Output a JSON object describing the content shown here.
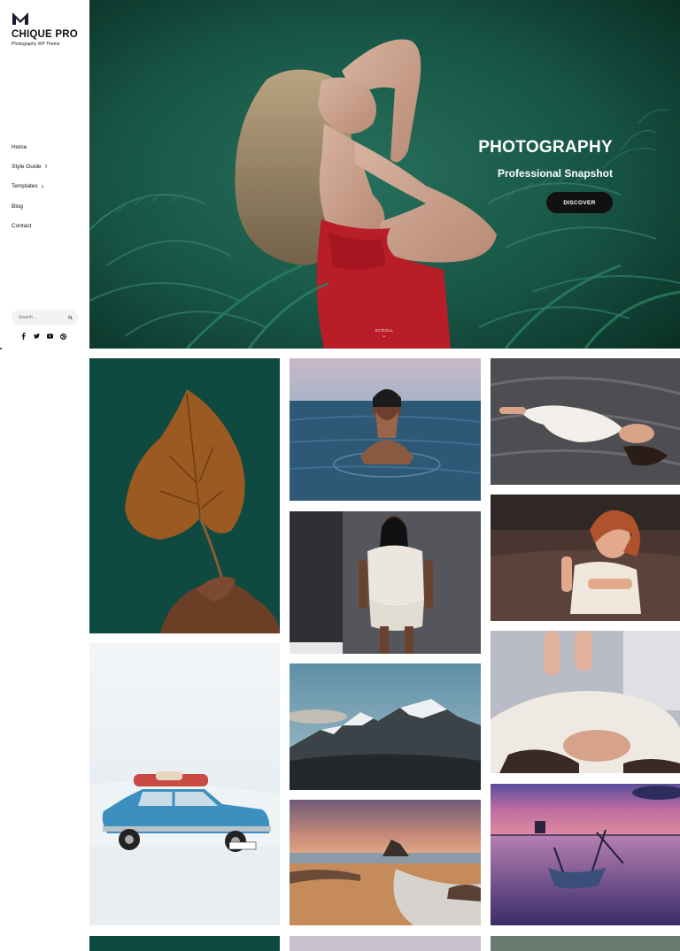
{
  "site": {
    "title": "CHIQUE PRO",
    "tagline": "Photography WP Theme"
  },
  "nav": {
    "items": [
      {
        "label": "Home",
        "has_submenu": false
      },
      {
        "label": "Style Guide",
        "has_submenu": true
      },
      {
        "label": "Templates",
        "has_submenu": true
      },
      {
        "label": "Blog",
        "has_submenu": false
      },
      {
        "label": "Contact",
        "has_submenu": false
      }
    ]
  },
  "search": {
    "placeholder": "Search ..."
  },
  "social": [
    "facebook-icon",
    "twitter-icon",
    "youtube-icon",
    "dribbble-icon"
  ],
  "hero": {
    "title": "PHOTOGRAPHY",
    "subtitle": "Professional Snapshot",
    "button_label": "DISCOVER",
    "scroll_label": "SCROLL"
  },
  "gallery": {
    "images": [
      "leaf-held-in-hand",
      "woman-in-sea",
      "woman-floating-in-water",
      "woman-in-white-sweater",
      "woman-on-leather-couch",
      "woman-lying-in-white-sweater",
      "blue-car-in-snow",
      "snowy-mountains",
      "beach-at-sunset",
      "boat-at-purple-dusk"
    ]
  },
  "colors": {
    "hero_green": "#1f5a4a",
    "button_dark": "#111111",
    "accent_red": "#c8202c"
  }
}
